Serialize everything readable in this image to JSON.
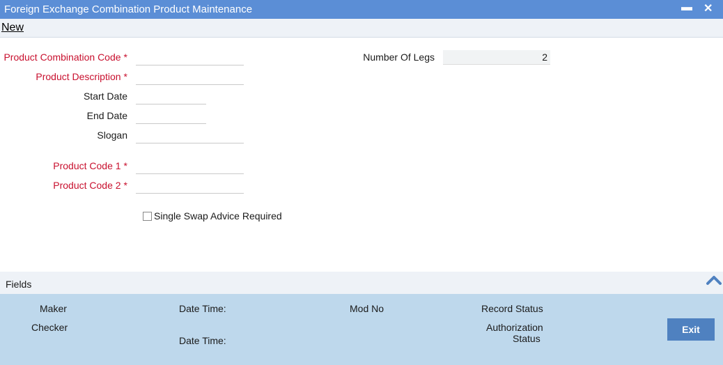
{
  "window": {
    "title": "Foreign Exchange Combination Product Maintenance",
    "minimize": "▬",
    "close": "✕"
  },
  "toolbar": {
    "new_label": "New"
  },
  "form": {
    "product_combination_code": {
      "label": "Product Combination Code",
      "value": ""
    },
    "product_description": {
      "label": "Product Description",
      "value": ""
    },
    "start_date": {
      "label": "Start Date",
      "value": ""
    },
    "end_date": {
      "label": "End Date",
      "value": ""
    },
    "slogan": {
      "label": "Slogan",
      "value": ""
    },
    "product_code_1": {
      "label": "Product Code 1",
      "value": ""
    },
    "product_code_2": {
      "label": "Product Code 2",
      "value": ""
    },
    "number_of_legs": {
      "label": "Number Of Legs",
      "value": "2"
    },
    "single_swap_advice": {
      "label": "Single Swap Advice Required",
      "checked": false
    },
    "required_marker": "*"
  },
  "fields_bar": {
    "label": "Fields",
    "icon": "chevron-up-icon"
  },
  "footer": {
    "maker": "Maker",
    "checker": "Checker",
    "date_time_1": "Date Time:",
    "date_time_2": "Date Time:",
    "mod_no": "Mod No",
    "record_status": "Record Status",
    "authorization_status_line1": "Authorization",
    "authorization_status_line2": "Status",
    "exit_label": "Exit"
  },
  "colors": {
    "titlebar": "#5b8ed6",
    "required": "#c8102e",
    "footer": "#bed8ec",
    "exit_button": "#4f81c0"
  }
}
